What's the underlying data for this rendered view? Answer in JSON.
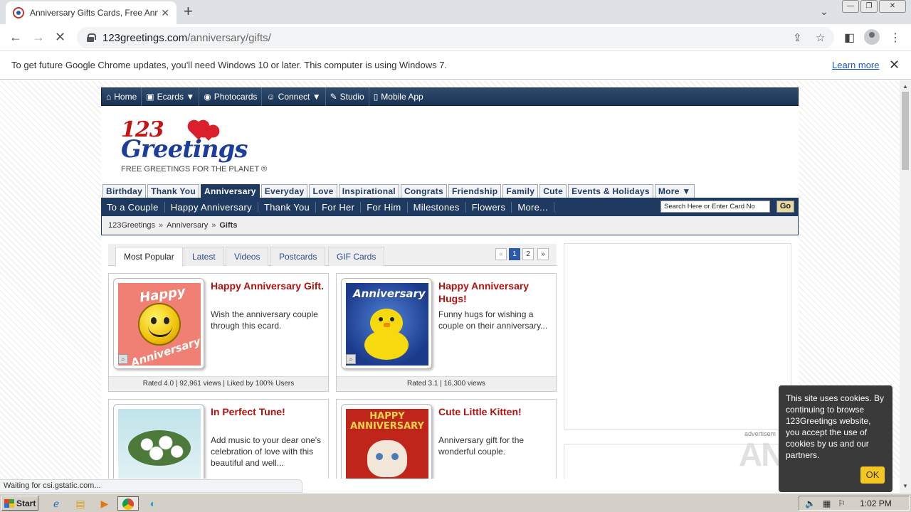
{
  "browser": {
    "tab_title": "Anniversary Gifts Cards, Free Anniv",
    "tab_close": "✕",
    "new_tab": "+",
    "url_host": "123greetings.com",
    "url_path": "/anniversary/gifts/"
  },
  "infobar": {
    "message": "To get future Google Chrome updates, you'll need Windows 10 or later. This computer is using Windows 7.",
    "learn_more": "Learn more"
  },
  "site": {
    "topnav": [
      "Home",
      "Ecards",
      "Photocards",
      "Connect",
      "Studio",
      "Mobile App"
    ],
    "logo": {
      "number": "123",
      "word": "Greetings",
      "tagline": "FREE GREETINGS FOR THE PLANET ®"
    },
    "categories": [
      "Birthday",
      "Thank You",
      "Anniversary",
      "Everyday",
      "Love",
      "Inspirational",
      "Congrats",
      "Friendship",
      "Family",
      "Cute",
      "Events & Holidays",
      "More"
    ],
    "active_category": "Anniversary",
    "subnav": [
      "To a Couple",
      "Happy Anniversary",
      "Thank You",
      "For Her",
      "For Him",
      "Milestones",
      "Flowers",
      "More..."
    ],
    "search_placeholder": "Search Here or Enter Card No",
    "go_label": "Go",
    "breadcrumb": [
      "123Greetings",
      "Anniversary",
      "Gifts"
    ],
    "content_tabs": [
      "Most Popular",
      "Latest",
      "Videos",
      "Postcards",
      "GIF Cards"
    ],
    "pager": [
      "«",
      "1",
      "2",
      "»"
    ],
    "cards": [
      {
        "title": "Happy Anniversary Gift.",
        "desc": "Wish the anniversary couple through this ecard.",
        "rating": "Rated 4.0 | 92,961 views | Liked by 100% Users",
        "thumb_text_top": "Happy",
        "thumb_text_bottom": "Anniversary"
      },
      {
        "title": "Happy Anniversary Hugs!",
        "desc": "Funny hugs for wishing a couple on their anniversary...",
        "rating": "Rated 3.1 | 16,300 views",
        "thumb_text_top": "Anniversary"
      },
      {
        "title": "In Perfect Tune!",
        "desc": "Add music to your dear one's celebration of love with this beautiful and well..."
      },
      {
        "title": "Cute Little Kitten!",
        "desc": "Anniversary gift for the wonderful couple.",
        "thumb_text_top": "HAPPY ANNIVERSARY"
      }
    ],
    "ad_label": "advertisem",
    "cookie": {
      "text": "This site uses cookies. By continuing to browse 123Greetings website, you accept the use of cookies by us and our partners.",
      "ok": "OK"
    }
  },
  "status_text": "Waiting for csi.gstatic.com...",
  "watermark": "ANY RUN",
  "taskbar": {
    "start": "Start",
    "clock": "1:02 PM"
  }
}
